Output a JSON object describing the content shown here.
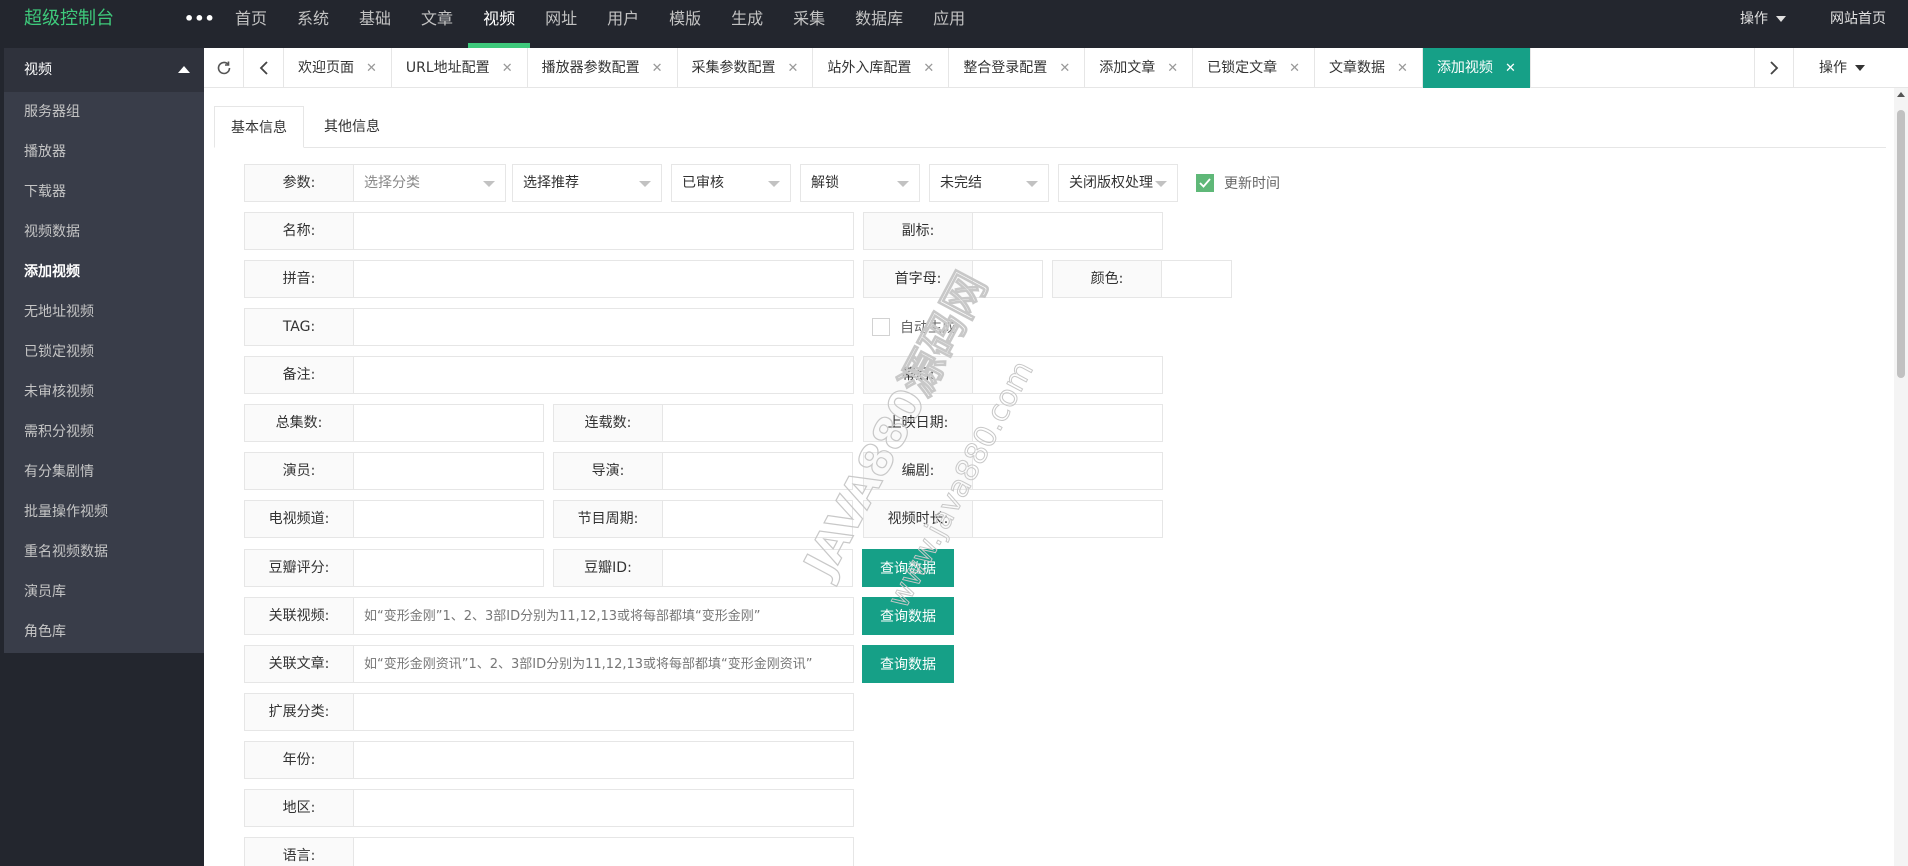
{
  "header": {
    "logo": "超级控制台",
    "more": "•••",
    "nav": [
      "首页",
      "系统",
      "基础",
      "文章",
      "视频",
      "网址",
      "用户",
      "模版",
      "生成",
      "采集",
      "数据库",
      "应用"
    ],
    "active_nav": "视频",
    "operate": "操作",
    "site_home": "网站首页"
  },
  "sidebar": {
    "title": "视频",
    "items": [
      "服务器组",
      "播放器",
      "下载器",
      "视频数据",
      "添加视频",
      "无地址视频",
      "已锁定视频",
      "未审核视频",
      "需积分视频",
      "有分集剧情",
      "批量操作视频",
      "重名视频数据",
      "演员库",
      "角色库"
    ],
    "active": "添加视频"
  },
  "tabbar": {
    "tabs": [
      "欢迎页面",
      "URL地址配置",
      "播放器参数配置",
      "采集参数配置",
      "站外入库配置",
      "整合登录配置",
      "添加文章",
      "已锁定文章",
      "文章数据",
      "添加视频"
    ],
    "active": "添加视频",
    "close_glyph": "✕",
    "operate": "操作"
  },
  "subtabs": [
    "基本信息",
    "其他信息"
  ],
  "form": {
    "params": {
      "label": "参数:",
      "category": "选择分类",
      "recommend": "选择推荐",
      "audit": "已审核",
      "lock": "解锁",
      "finish": "未完结",
      "copyright": "关闭版权处理",
      "update_time": "更新时间",
      "update_time_checked": true
    },
    "name_label": "名称:",
    "subtitle_label": "副标:",
    "pinyin_label": "拼音:",
    "initial_label": "首字母:",
    "color_label": "颜色:",
    "tag_label": "TAG:",
    "auto_generate": "自动生成",
    "auto_generate_checked": false,
    "remark_label": "备注:",
    "behind_label": "幕后:",
    "total_label": "总集数:",
    "serial_label": "连载数:",
    "release_label": "上映日期:",
    "actor_label": "演员:",
    "director_label": "导演:",
    "writer_label": "编剧:",
    "tv_label": "电视频道:",
    "weekday_label": "节目周期:",
    "duration_label": "视频时长:",
    "douban_score_label": "豆瓣评分:",
    "douban_id_label": "豆瓣ID:",
    "rel_vod_label": "关联视频:",
    "rel_vod_placeholder": "如“变形金刚”1、2、3部ID分别为11,12,13或将每部都填“变形金刚”",
    "rel_art_label": "关联文章:",
    "rel_art_placeholder": "如“变形金刚资讯”1、2、3部ID分别为11,12,13或将每部都填“变形金刚资讯”",
    "query_button": "查询数据",
    "class_label": "扩展分类:",
    "year_label": "年份:",
    "area_label": "地区:",
    "lang_label": "语言:"
  },
  "watermark": {
    "line1": "JAVA880源码网",
    "line2": "www.java880.com"
  },
  "colors": {
    "accent": "#16a087",
    "logo": "#3ec97b",
    "topbar": "#23262e",
    "sidebar": "#393d49",
    "checkbox": "#5fb878"
  }
}
